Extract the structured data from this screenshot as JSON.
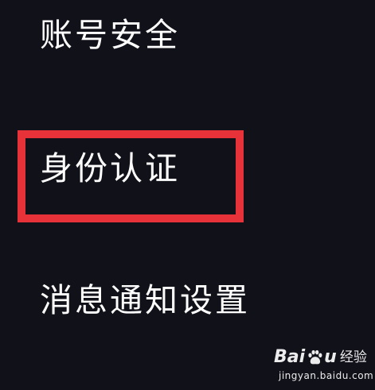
{
  "menu": {
    "items": [
      {
        "label": "账号安全"
      },
      {
        "label": "身份认证",
        "highlighted": true
      },
      {
        "label": "消息通知设置"
      }
    ]
  },
  "highlight": {
    "color": "#e8323a",
    "target": "身份认证"
  },
  "watermark": {
    "brand_left": "Bai",
    "brand_icon": "paw-icon",
    "brand_right": "u",
    "product": "经验",
    "url": "jingyan.baidu.com"
  },
  "colors": {
    "background": "#11111a",
    "text": "#ffffff",
    "highlight_border": "#e8323a"
  }
}
